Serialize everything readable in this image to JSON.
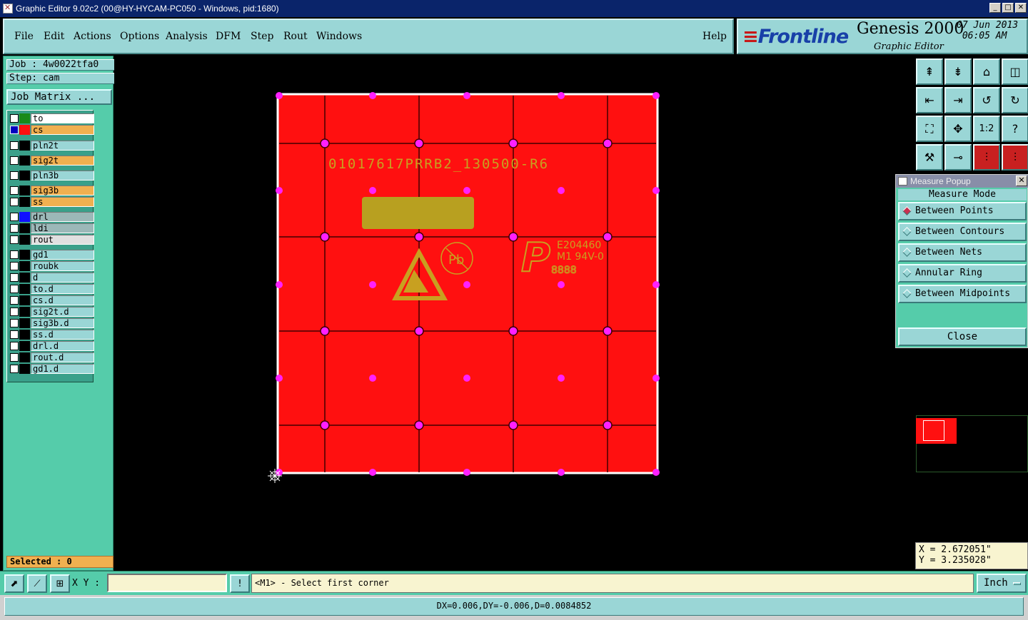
{
  "window": {
    "title": "Graphic Editor 9.02c2 (00@HY-HYCAM-PC050 - Windows, pid:1680)"
  },
  "menu": {
    "items": [
      "File",
      "Edit",
      "Actions",
      "Options",
      "Analysis",
      "DFM",
      "Step",
      "Rout",
      "Windows"
    ],
    "help": "Help"
  },
  "logo": {
    "brand": "Frontline",
    "product": "Genesis 2000",
    "subtitle": "Graphic Editor",
    "date": "07 Jun 2013",
    "time": "06:05 AM"
  },
  "job": {
    "job": "Job : 4w0022tfa0",
    "step": "Step: cam",
    "matrix_button": "Job Matrix ..."
  },
  "layers": [
    {
      "name": "to",
      "color": "#1a8a1a",
      "bg": "#ffffff",
      "checked": false
    },
    {
      "name": "cs",
      "color": "#ff1010",
      "bg": "#f0b050",
      "checked": true,
      "mark": "⊠"
    },
    {
      "name": "pln2t",
      "color": "#000000",
      "bg": "#9ad6d6",
      "checked": false
    },
    {
      "name": "sig2t",
      "color": "#000000",
      "bg": "#f0b050",
      "checked": false
    },
    {
      "name": "pln3b",
      "color": "#000000",
      "bg": "#9ad6d6",
      "checked": false
    },
    {
      "name": "sig3b",
      "color": "#000000",
      "bg": "#f0b050",
      "checked": false
    },
    {
      "name": "ss",
      "color": "#000000",
      "bg": "#f0b050",
      "checked": false
    },
    {
      "name": "drl",
      "color": "#1010ff",
      "bg": "#9cb8b8",
      "checked": false
    },
    {
      "name": "ldi",
      "color": "#000000",
      "bg": "#9cb8b8",
      "checked": false
    },
    {
      "name": "rout",
      "color": "#000000",
      "bg": "#e0e0e0",
      "checked": false
    },
    {
      "name": "gd1",
      "color": "#000000",
      "bg": "#9ad6d6",
      "checked": false,
      "mark": "◢"
    },
    {
      "name": "roubk",
      "color": "#000000",
      "bg": "#9ad6d6",
      "checked": false
    },
    {
      "name": "d",
      "color": "#000000",
      "bg": "#9ad6d6",
      "checked": false
    },
    {
      "name": "to.d",
      "color": "#000000",
      "bg": "#9ad6d6",
      "checked": false
    },
    {
      "name": "cs.d",
      "color": "#000000",
      "bg": "#9ad6d6",
      "checked": false
    },
    {
      "name": "sig2t.d",
      "color": "#000000",
      "bg": "#9ad6d6",
      "checked": false
    },
    {
      "name": "sig3b.d",
      "color": "#000000",
      "bg": "#9ad6d6",
      "checked": false
    },
    {
      "name": "ss.d",
      "color": "#000000",
      "bg": "#9ad6d6",
      "checked": false
    },
    {
      "name": "drl.d",
      "color": "#000000",
      "bg": "#9ad6d6",
      "checked": false
    },
    {
      "name": "rout.d",
      "color": "#000000",
      "bg": "#9ad6d6",
      "checked": false
    },
    {
      "name": "gd1.d",
      "color": "#000000",
      "bg": "#9ad6d6",
      "checked": false,
      "mark": "◢"
    }
  ],
  "selected": "Selected : 0",
  "board": {
    "text": "01017617PRRB2_130500-R6",
    "ul_text": [
      "E204460",
      "M1 94V-0",
      "8888"
    ],
    "pb": "Pb"
  },
  "measure": {
    "title": "Measure Popup",
    "header": "Measure Mode",
    "options": [
      "Between Points",
      "Between Contours",
      "Between Nets",
      "Annular Ring",
      "Between Midpoints"
    ],
    "selected_index": 0,
    "close": "Close"
  },
  "coords": {
    "x": "X = 2.672051\"",
    "y": "Y = 3.235028\""
  },
  "bottom": {
    "xy_label": "X Y :",
    "xy_value": "",
    "prompt": "<M1> - Select first corner",
    "units": "Inch"
  },
  "status": "DX=0.006,DY=-0.006,D=0.0084852",
  "colors": {
    "board": "#ff1010",
    "pad": "#ff20ff",
    "silk": "#c8a020",
    "panel": "#55ccaa",
    "button": "#9ad6d6"
  },
  "toolbar_icons": [
    "page-up-icon",
    "page-down-icon",
    "home-icon",
    "split-view-icon",
    "pan-left-icon",
    "pan-right-icon",
    "undo-view-icon",
    "redraw-icon",
    "fit-screen-icon",
    "zoom-fit-icon",
    "one-to-two-icon",
    "help-icon",
    "tools-icon",
    "probe-icon",
    "measure-net-icon",
    "measure-layer-icon"
  ]
}
